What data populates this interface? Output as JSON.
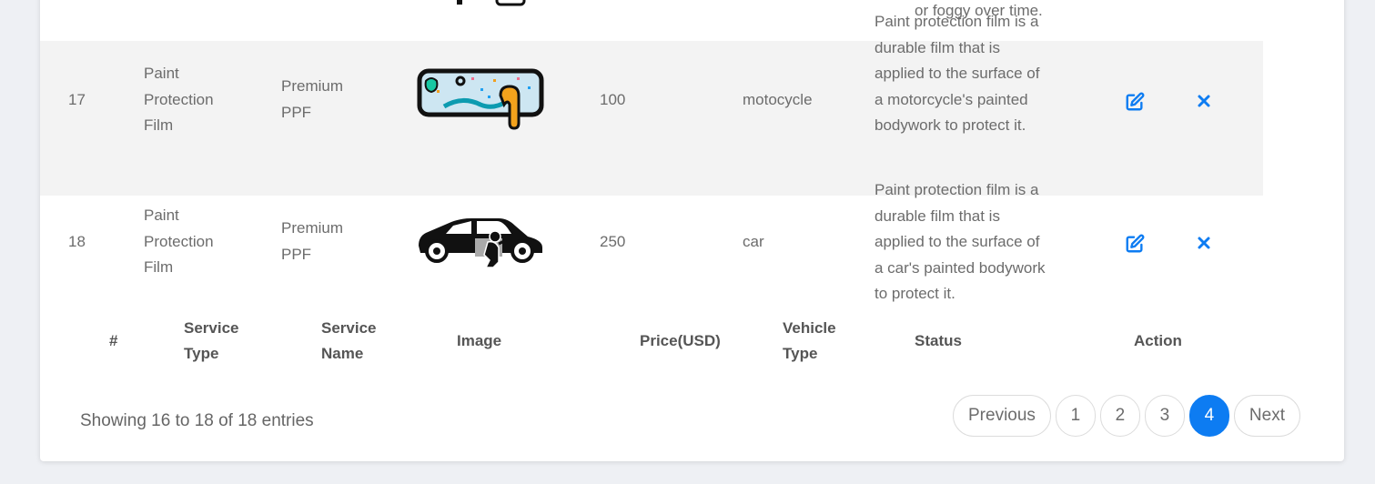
{
  "header": {
    "cols": [
      "#",
      "Service Type",
      "Service Name",
      "Image",
      "Price(USD)",
      "Vehicle Type",
      "Status",
      "Action"
    ]
  },
  "partial_row": {
    "status_tail": "or foggy over time."
  },
  "rows": [
    {
      "num": "17",
      "service_type": "Paint Protection Film",
      "service_name": "Premium PPF",
      "image": "film-peel-icon",
      "price": "100",
      "vehicle_type": "motocycle",
      "status": "Paint protection film is a durable film that is applied to the surface of a motorcycle's painted bodywork to protect it."
    },
    {
      "num": "18",
      "service_type": "Paint Protection Film",
      "service_name": "Premium PPF",
      "image": "car-ppf-icon",
      "price": "250",
      "vehicle_type": "car",
      "status": "Paint protection film is a durable film that is applied to the surface of a car's painted bodywork to protect it."
    }
  ],
  "footer": {
    "info": "Showing 16 to 18 of 18 entries",
    "previous": "Previous",
    "pages": [
      "1",
      "2",
      "3",
      "4"
    ],
    "active_page": "4",
    "next": "Next"
  },
  "colors": {
    "accent": "#0d7cf2",
    "row_alt": "#f3f3f3"
  }
}
